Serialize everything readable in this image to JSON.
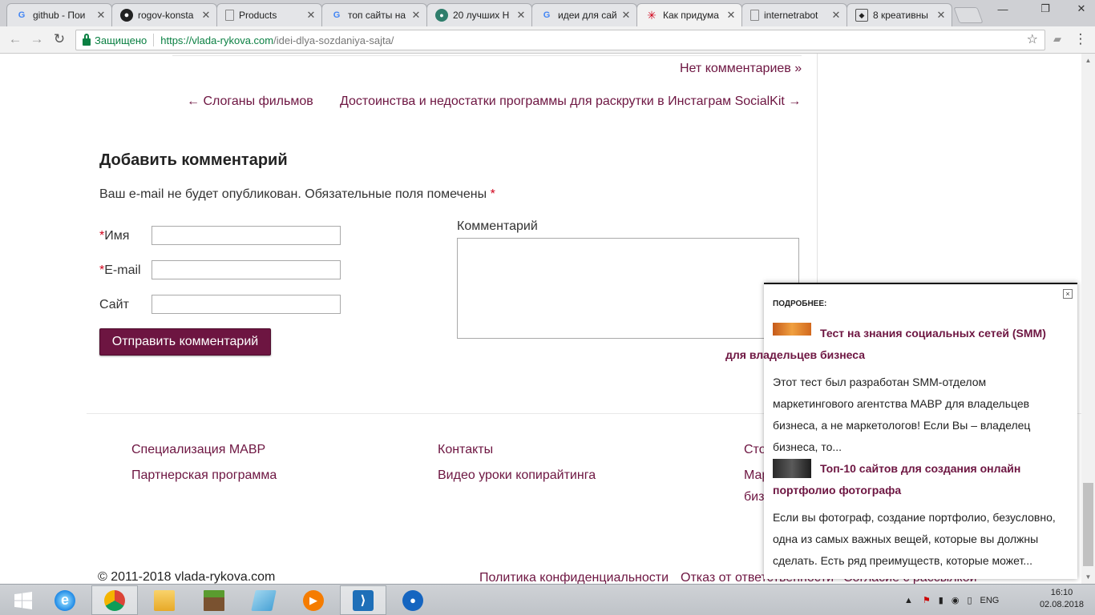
{
  "browser": {
    "tabs": [
      {
        "title": "github - Пои",
        "icon": "google-icon"
      },
      {
        "title": "rogov-konsta",
        "icon": "github-icon"
      },
      {
        "title": "Products",
        "icon": "page-icon"
      },
      {
        "title": "топ сайты на",
        "icon": "google-icon"
      },
      {
        "title": "20 лучших Н",
        "icon": "site-icon"
      },
      {
        "title": "идеи для сай",
        "icon": "google-icon"
      },
      {
        "title": "Как придума",
        "icon": "site-icon"
      },
      {
        "title": "internetrabot",
        "icon": "page-icon"
      },
      {
        "title": "8 креативны",
        "icon": "shield-icon"
      }
    ],
    "active_tab_index": 6,
    "secure_label": "Защищено",
    "url_host": "https://vlada-rykova.com",
    "url_path": "/idei-dlya-sozdaniya-sajta/"
  },
  "post_nav": {
    "no_comments": "Нет комментариев »",
    "prev": "← Слоганы фильмов",
    "next": "Достоинства и недостатки программы для раскрутки в Инстаграм SocialKit →"
  },
  "comment_form": {
    "heading": "Добавить комментарий",
    "note": "Ваш e-mail не будет опубликован. Обязательные поля помечены",
    "required_mark": "*",
    "name_label": "Имя",
    "email_label": "E-mail",
    "site_label": "Сайт",
    "name_value": "",
    "email_value": "",
    "site_value": "",
    "comment_label": "Комментарий",
    "comment_value": "",
    "submit_label": "Отправить комментарий"
  },
  "footer": {
    "col1": [
      "Специализация МАВР",
      "Партнерская программа"
    ],
    "col2": [
      "Контакты",
      "Видео уроки копирайтинга"
    ],
    "col3": [
      "Сто",
      "Мар",
      "биз"
    ],
    "copyright": "© 2011-2018 vlada-rykova.com",
    "bottom_links": [
      "Политика конфиденциальности",
      "Отказ от ответственности",
      "Согласие с рассылкой"
    ]
  },
  "popup": {
    "header": "ПОДРОБНЕЕ:",
    "close": "×",
    "items": [
      {
        "title_line1": "Тест на знания социальных сетей (SMM)",
        "title_line2": "для владельцев бизнеса",
        "text_lines": [
          "Этот тест был разработан SMM-отделом",
          "маркетингового агентства МАВР для владельцев",
          "бизнеса, а не маркетологов! Если Вы – владелец",
          "бизнеса, то..."
        ]
      },
      {
        "title_line1": "Топ-10 сайтов для создания онлайн",
        "title_line2": "портфолио фотографа",
        "text_lines": [
          "Если вы фотограф, создание портфолио, безусловно,",
          "одна из самых важных вещей, которые вы должны",
          "сделать. Есть ряд преимуществ, которые может..."
        ]
      }
    ]
  },
  "taskbar": {
    "apps": [
      "start-icon",
      "ie-icon",
      "chrome-icon",
      "explorer-icon",
      "minecraft-icon",
      "notepad-icon",
      "media-player-icon",
      "vscode-icon",
      "maps-icon"
    ],
    "language": "ENG",
    "time": "16:10",
    "date": "02.08.2018"
  },
  "colors": {
    "accent": "#6d1541",
    "secure_green": "#0b8043",
    "required_red": "#d0021b"
  }
}
